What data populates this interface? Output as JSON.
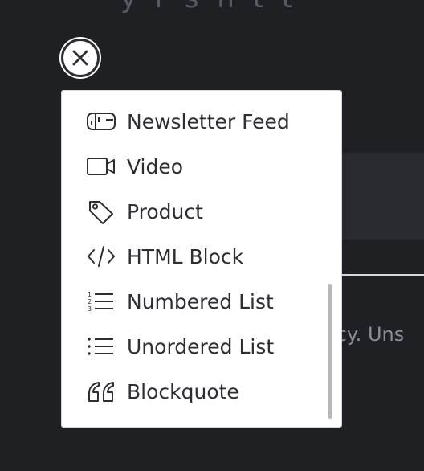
{
  "background": {
    "heading_fragment": "y  r s  h  t  t",
    "text_fragment": "acy. Uns"
  },
  "close_button": {
    "icon": "close-icon",
    "color": "#2d2e33"
  },
  "menu": {
    "items": [
      {
        "label": "Newsletter Feed",
        "icon": "newsletter-icon"
      },
      {
        "label": "Video",
        "icon": "video-icon"
      },
      {
        "label": "Product",
        "icon": "tag-icon"
      },
      {
        "label": "HTML Block",
        "icon": "code-icon"
      },
      {
        "label": "Numbered List",
        "icon": "numbered-list-icon"
      },
      {
        "label": "Unordered List",
        "icon": "unordered-list-icon"
      },
      {
        "label": "Blockquote",
        "icon": "quote-icon"
      }
    ]
  },
  "colors": {
    "page_background": "#1f2024",
    "menu_background": "#ffffff",
    "text": "#2d2e33",
    "scrollbar": "#b8b8b8"
  }
}
